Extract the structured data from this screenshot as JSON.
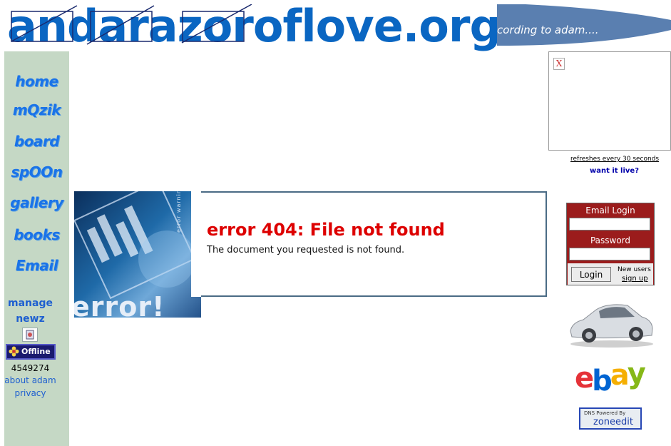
{
  "header": {
    "logo_text": "andarazoroflove.org",
    "tagline": "cording to adam...."
  },
  "nav": {
    "items": [
      {
        "label": "home"
      },
      {
        "label": "mQzik"
      },
      {
        "label": "board"
      },
      {
        "label": "spOOn"
      },
      {
        "label": "gallery"
      },
      {
        "label": "books"
      },
      {
        "label": "Email"
      }
    ],
    "manage_line1": "manage",
    "manage_line2": "newz",
    "offline_label": "Offline",
    "counter": "4549274",
    "about_link": "about adam",
    "privacy_link": "privacy"
  },
  "error": {
    "image_caption": "error!",
    "image_side_text": "error warning!",
    "title": "error 404: File not found",
    "message": "The document you requested is not found."
  },
  "sidebar_right": {
    "broken_image_glyph": "X",
    "refresh_note": "refreshes every 30 seconds",
    "want_live": "want it live?",
    "login": {
      "email_label": "Email Login",
      "password_label": "Password",
      "email_value": "",
      "password_value": "",
      "button_label": "Login",
      "new_users": "New users",
      "signup": "sign up"
    },
    "ebay": [
      "e",
      "b",
      "a",
      "y"
    ],
    "ebay_colors": [
      "#e53238",
      "#0064d2",
      "#f5af02",
      "#86b817"
    ],
    "zoneedit_line1": "DNS Powered By",
    "zoneedit_line2": "zoneedit"
  },
  "colors": {
    "brand_blue": "#0a66c2",
    "sidebar_bg": "#c5d8c5",
    "error_red": "#dd0000",
    "login_bg": "#9b1c1c"
  }
}
